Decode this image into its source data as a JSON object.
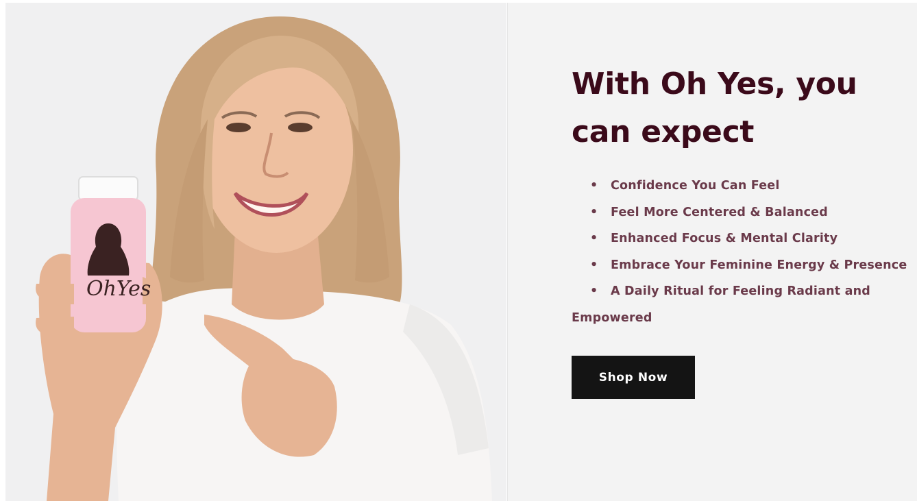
{
  "hero": {
    "brand_label": "OhYes"
  },
  "content": {
    "headline": "With Oh Yes, you can expect",
    "benefits": [
      "Confidence You Can Feel",
      "Feel More Centered & Balanced",
      "Enhanced Focus & Mental Clarity",
      "Embrace Your Feminine Energy & Presence",
      "A Daily Ritual for Feeling Radiant and",
      "Empowered"
    ],
    "bullet": "•",
    "cta_label": "Shop Now"
  },
  "colors": {
    "headline": "#3b0a1a",
    "benefit_text": "#6a3a4a",
    "button_bg": "#141414",
    "button_text": "#ffffff",
    "panel_bg": "#f3f3f3",
    "bottle": "#f6c6d2"
  }
}
